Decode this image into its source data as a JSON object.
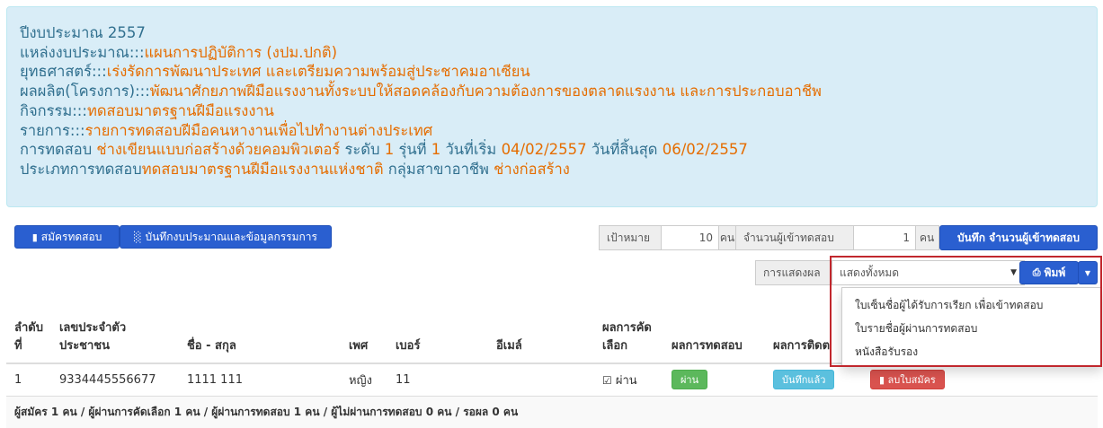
{
  "info": {
    "fiscal_year_label": "ปีงบประมาณ 2557",
    "budget_source_label": "แหล่งงบประมาณ:::",
    "budget_source_value": "แผนการปฏิบัติการ (งปม.ปกติ)",
    "strategy_label": "ยุทธศาสตร์:::",
    "strategy_value": "เร่งรัดการพัฒนาประเทศ และเตรียมความพร้อมสู่ประชาคมอาเซียน",
    "output_label": "ผลผลิต(โครงการ):::",
    "output_value": "พัฒนาศักยภาพฝีมือแรงงานทั้งระบบให้สอดคล้องกับความต้องการของตลาดแรงงาน และการประกอบอาชีพ",
    "activity_label": "กิจกรรม:::",
    "activity_value": "ทดสอบมาตรฐานฝีมือแรงงาน",
    "item_label": "รายการ:::",
    "item_value": "รายการทดสอบฝีมือคนหางานเพื่อไปทำงานต่างประเทศ",
    "test_label": "การทดสอบ",
    "test_value": "ช่างเขียนแบบก่อสร้างด้วยคอมพิวเตอร์",
    "level_label": "ระดับ",
    "level_value": "1",
    "round_label": "รุ่นที่",
    "round_value": "1",
    "start_label": "วันที่เริ่ม",
    "start_value": "04/02/2557",
    "end_label": "วันที่สิ้นสุด",
    "end_value": "06/02/2557",
    "type_label": "ประเภทการทดสอบ",
    "type_value": "ทดสอบมาตรฐานฝีมือแรงงานแห่งชาติ",
    "group_label": "กลุ่มสาขาอาชีพ",
    "group_value": "ช่างก่อสร้าง"
  },
  "toolbar": {
    "apply_label": "สมัครทดสอบ",
    "budget_label": "บันทึกงบประมาณและข้อมูลกรรมการ",
    "target_label": "เป้าหมาย",
    "target_value": "10",
    "unit1": "คน",
    "count_label": "จำนวนผู้เข้าทดสอบ",
    "count_value": "1",
    "unit2": "คน",
    "save_label": "บันทึก จำนวนผู้เข้าทดสอบ",
    "display_label": "การแสดงผล",
    "display_selected": "แสดงทั้งหมด",
    "print_label": "พิมพ์"
  },
  "dropdown": {
    "items": [
      "ใบเซ็นชื่อผู้ได้รับการเรียก เพื่อเข้าทดสอบ",
      "ใบรายชื่อผู้ผ่านการทดสอบ",
      "หนังสือรับรอง"
    ]
  },
  "table": {
    "headers": [
      "ลำดับที่",
      "เลขประจำตัวประชาชน",
      "ชื่อ - สกุล",
      "เพศ",
      "เบอร์",
      "อีเมล์",
      "ผลการคัดเลือก",
      "ผลการทดสอบ",
      "ผลการติดต"
    ],
    "rows": [
      {
        "no": "1",
        "id": "9334445556677",
        "name": "1111 111",
        "sex": "หญิง",
        "phone": "11",
        "email": "",
        "selection": "ผ่าน",
        "result_btn": "ผ่าน",
        "follow_btn": "บันทึกแล้ว",
        "delete_btn": "ลบใบสมัคร"
      }
    ],
    "summary": "ผู้สมัคร 1 คน / ผู้ผ่านการคัดเลือก 1 คน / ผู้ผ่านการทดสอบ 1 คน / ผู้ไม่ผ่านการทดสอบ 0 คน / รอผล 0 คน"
  }
}
